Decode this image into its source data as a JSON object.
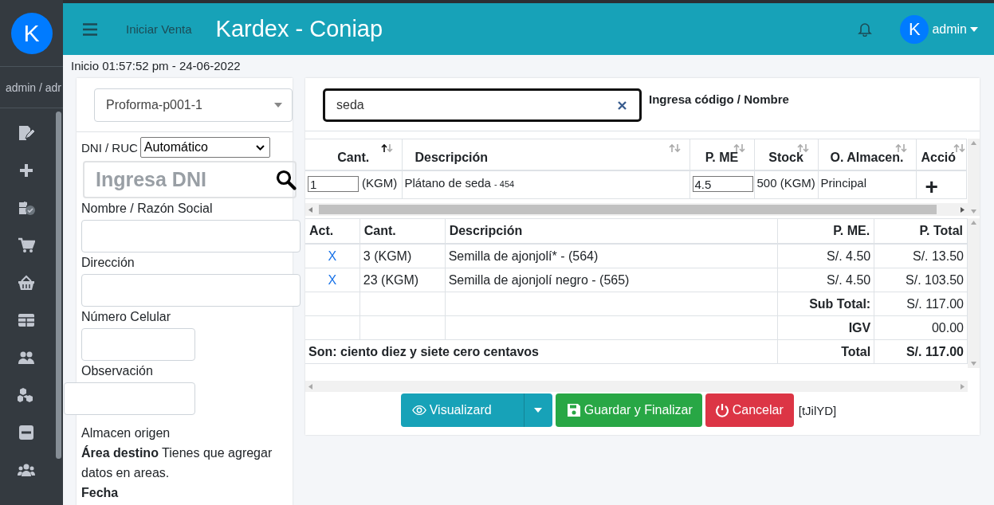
{
  "sidebar": {
    "avatar_letter": "K",
    "user": "admin / adr"
  },
  "header": {
    "link": "Iniciar Venta",
    "title": "Kardex - Coniap",
    "avatar_letter": "K",
    "user": "admin"
  },
  "session_info": "Inicio 01:57:52 pm - 24-06-2022",
  "client_form": {
    "document_select": "Proforma-p001-1",
    "id_label": "DNI / RUC",
    "id_type": "Automático",
    "id_placeholder": "Ingresa DNI",
    "fields": [
      {
        "label": "Nombre / Razón Social",
        "kind": "wide"
      },
      {
        "label": "Dirección",
        "kind": "wide"
      },
      {
        "label": "Número Celular",
        "kind": "short"
      },
      {
        "label": "Observación",
        "kind": "offset"
      }
    ],
    "warehouse_label": "Almacen origen",
    "area_note": "**Área destino** Tienes que agregar datos en areas.",
    "date_label": "Fecha"
  },
  "search": {
    "value": "seda",
    "hint": "Ingresa código / Nombre"
  },
  "results_table": {
    "columns": [
      {
        "label": "Cant.",
        "sorted": true
      },
      {
        "label": "Descripción",
        "sorted": false
      },
      {
        "label": "P. ME",
        "sorted": false
      },
      {
        "label": "Stock",
        "sorted": false
      },
      {
        "label": "O. Almacen.",
        "sorted": false
      },
      {
        "label": "Acció",
        "sorted": false
      }
    ],
    "rows": [
      {
        "quantity": "1",
        "unit": "(KGM)",
        "description": "Plátano de seda",
        "code": "- 454",
        "price": "4.5",
        "stock": "500 (KGM)",
        "warehouse": "Principal",
        "action": "+"
      }
    ]
  },
  "cart_table": {
    "columns": [
      "Act.",
      "Cant.",
      "Descripción",
      "P. ME.",
      "P. Total"
    ],
    "rows": [
      {
        "action": "X",
        "quantity": "3 (KGM)",
        "description": "Semilla de ajonjolí* - (564)",
        "price": "S/. 4.50",
        "total": "S/. 13.50"
      },
      {
        "action": "X",
        "quantity": "23 (KGM)",
        "description": "Semilla de ajonjolí negro - (565)",
        "price": "S/. 4.50",
        "total": "S/. 103.50"
      }
    ],
    "subtotal_label": "Sub Total:",
    "subtotal": "S/. 117.00",
    "tax_label": "IGV",
    "tax": "00.00",
    "words": "Son: ciento diez y siete cero centavos",
    "total_label": "Total",
    "total": "S/. 117.00"
  },
  "actions": {
    "preview": "Visualizard",
    "save": "Guardar y Finalizar",
    "cancel": "Cancelar",
    "code": "[tJilYD]"
  }
}
